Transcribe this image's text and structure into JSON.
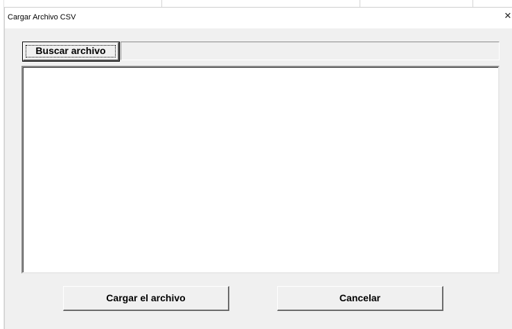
{
  "window": {
    "title": "Cargar Archivo CSV",
    "close_glyph": "✕"
  },
  "browse": {
    "label": "Buscar archivo"
  },
  "file_path": {
    "value": ""
  },
  "preview": {
    "content": ""
  },
  "actions": {
    "load_label": "Cargar el archivo",
    "cancel_label": "Cancelar"
  },
  "icons": {
    "close": "close-icon"
  },
  "colors": {
    "dialog_background": "#f0f0f0",
    "titlebar_background": "#ffffff",
    "preview_background": "#ffffff",
    "text": "#000000"
  }
}
